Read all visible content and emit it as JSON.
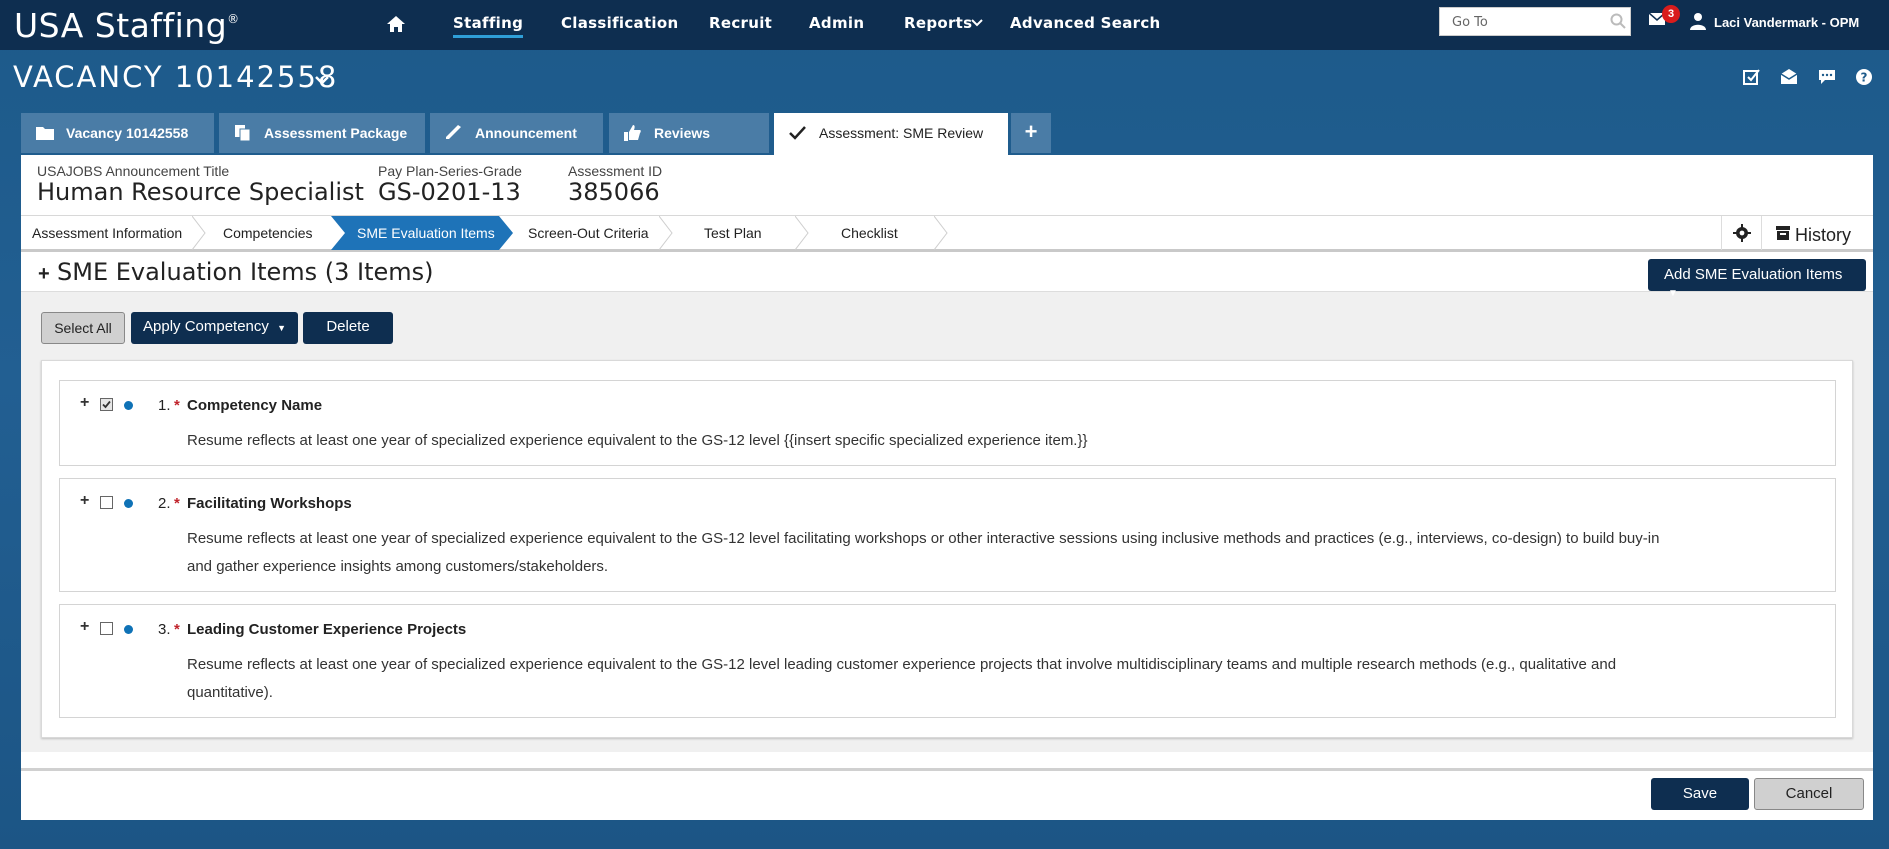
{
  "brand": {
    "name": "USA Staffing",
    "mark": "®"
  },
  "nav": {
    "items": [
      "Staffing",
      "Classification",
      "Recruit",
      "Admin",
      "Reports",
      "Advanced Search"
    ],
    "active": "Staffing"
  },
  "goto": {
    "placeholder": "Go To"
  },
  "notifications": {
    "count": "3"
  },
  "user": {
    "name": "Laci Vandermark - OPM"
  },
  "vacancy": {
    "title": "VACANCY 10142558"
  },
  "tabs": [
    {
      "label": "Vacancy 10142558",
      "icon": "folder-icon"
    },
    {
      "label": "Assessment Package",
      "icon": "copy-icon"
    },
    {
      "label": "Announcement",
      "icon": "pen-icon"
    },
    {
      "label": "Reviews",
      "icon": "thumbs-up-icon"
    },
    {
      "label": "Assessment: SME Review",
      "icon": "check-icon"
    }
  ],
  "meta": {
    "title_label": "USAJOBS Announcement Title",
    "title_value": "Human Resource Specialist",
    "grade_label": "Pay Plan-Series-Grade",
    "grade_value": "GS-0201-13",
    "id_label": "Assessment ID",
    "id_value": "385066"
  },
  "steps": [
    "Assessment Information",
    "Competencies",
    "SME Evaluation Items",
    "Screen-Out Criteria",
    "Test Plan",
    "Checklist"
  ],
  "active_step": "SME Evaluation Items",
  "history_label": "History",
  "section": {
    "title": "SME Evaluation Items (3 Items)",
    "add_button": "Add SME Evaluation Items"
  },
  "actions": {
    "select_all": "Select All",
    "apply_competency": "Apply Competency",
    "delete": "Delete"
  },
  "items": [
    {
      "num": "1.",
      "name": "Competency Name",
      "desc": "Resume reflects at least one year of specialized experience equivalent to the GS-12 level {{insert specific specialized experience item.}}",
      "checked": true
    },
    {
      "num": "2.",
      "name": "Facilitating Workshops",
      "desc_line1": "Resume reflects at least one year of specialized experience equivalent to the GS-12 level facilitating workshops or other interactive sessions using inclusive methods and practices (e.g., interviews, co-design) to build buy-in",
      "desc_line2": "and gather experience insights among customers/stakeholders.",
      "checked": false
    },
    {
      "num": "3.",
      "name": "Leading Customer Experience Projects",
      "desc_line1": "Resume reflects at least one year of specialized experience equivalent to the GS-12 level leading customer experience projects that involve multidisciplinary teams and multiple research methods (e.g., qualitative and",
      "desc_line2": "quantitative).",
      "checked": false
    }
  ],
  "footer": {
    "save": "Save",
    "cancel": "Cancel"
  },
  "colors": {
    "navy": "#0e2e50",
    "accent": "#2f9fd8",
    "required": "#c0232b",
    "dot": "#0f72b6"
  }
}
